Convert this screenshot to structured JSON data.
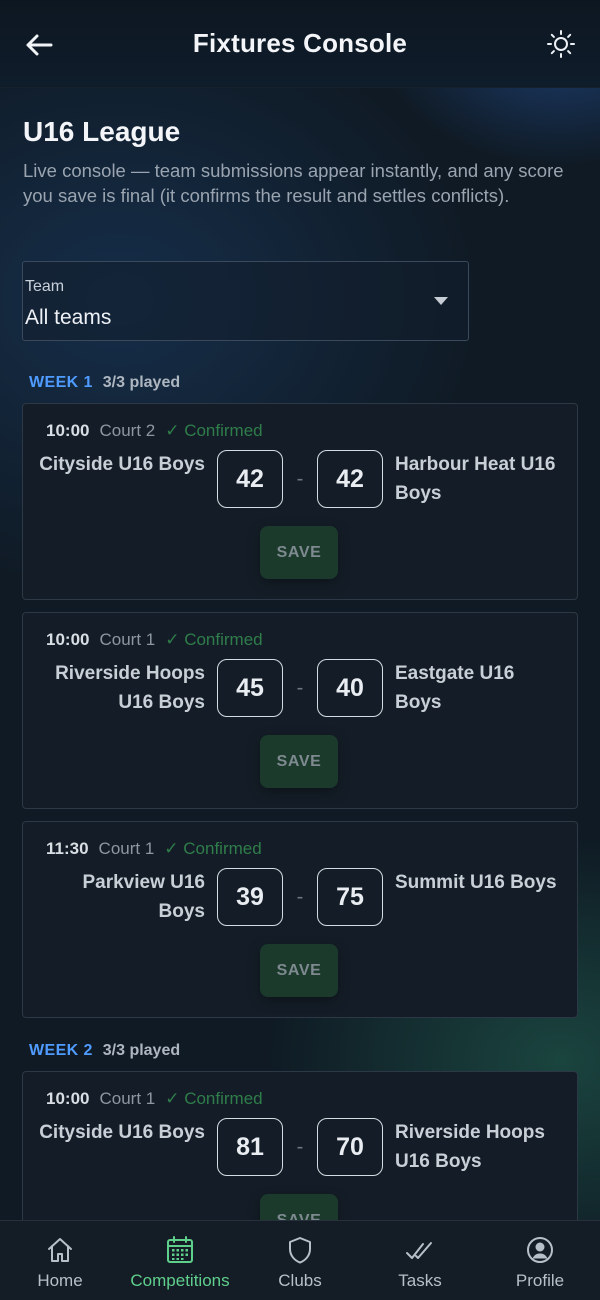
{
  "header": {
    "title": "Fixtures Console"
  },
  "league": {
    "title": "U16 League",
    "description": "Live console — team submissions appear instantly, and any score you save is final (it confirms the result and settles conflicts)."
  },
  "team_filter": {
    "label": "Team",
    "value": "All teams"
  },
  "weeks": [
    {
      "label": "WEEK 1",
      "played": "3/3 played"
    },
    {
      "label": "WEEK 2",
      "played": "3/3 played"
    }
  ],
  "fixtures": [
    {
      "time": "10:00",
      "court": "Court 2",
      "status": "✓ Confirmed",
      "home": "Cityside U16 Boys",
      "away": "Harbour Heat U16 Boys",
      "home_score": "42",
      "away_score": "42",
      "save": "SAVE"
    },
    {
      "time": "10:00",
      "court": "Court 1",
      "status": "✓ Confirmed",
      "home": "Riverside Hoops U16 Boys",
      "away": "Eastgate U16 Boys",
      "home_score": "45",
      "away_score": "40",
      "save": "SAVE"
    },
    {
      "time": "11:30",
      "court": "Court 1",
      "status": "✓ Confirmed",
      "home": "Parkview U16 Boys",
      "away": "Summit U16 Boys",
      "home_score": "39",
      "away_score": "75",
      "save": "SAVE"
    },
    {
      "time": "10:00",
      "court": "Court 1",
      "status": "✓ Confirmed",
      "home": "Cityside U16 Boys",
      "away": "Riverside Hoops U16 Boys",
      "home_score": "81",
      "away_score": "70",
      "save": "SAVE"
    }
  ],
  "score_separator": "-",
  "nav": [
    {
      "label": "Home",
      "icon": "home-icon"
    },
    {
      "label": "Competitions",
      "icon": "calendar-icon"
    },
    {
      "label": "Clubs",
      "icon": "shield-icon"
    },
    {
      "label": "Tasks",
      "icon": "double-check-icon"
    },
    {
      "label": "Profile",
      "icon": "profile-icon"
    }
  ],
  "colors": {
    "accent_green": "#5fcf8c",
    "week_blue": "#4f9bff",
    "confirmed_green": "#2f7d4a"
  }
}
